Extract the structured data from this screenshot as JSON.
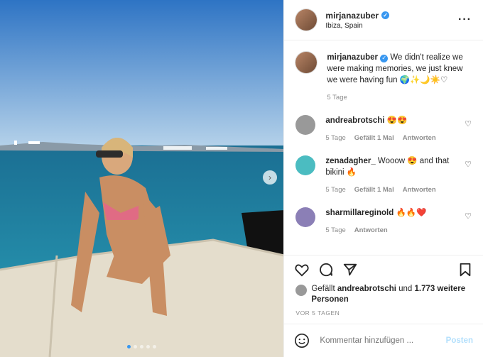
{
  "author": {
    "username": "mirjanazuber",
    "location": "Ibiza, Spain"
  },
  "caption": {
    "username": "mirjanazuber",
    "text": "We didn't realize we were making memories, we just knew we were having fun 🌍✨🌙☀️♡",
    "age": "5 Tage"
  },
  "comments": [
    {
      "username": "andreabrotschi",
      "text": "😍😍",
      "age": "5 Tage",
      "likes": "Gefällt 1 Mal",
      "reply": "Antworten"
    },
    {
      "username": "zenadagher_",
      "text": "Wooow 😍 and that bikini 🔥",
      "age": "5 Tage",
      "likes": "Gefällt 1 Mal",
      "reply": "Antworten"
    },
    {
      "username": "sharmillareginold",
      "text": "🔥🔥❤️",
      "age": "5 Tage",
      "likes": "",
      "reply": "Antworten"
    }
  ],
  "likes": {
    "prefix": "Gefällt",
    "user": "andreabrotschi",
    "mid": "und",
    "others": "1.773 weitere Personen"
  },
  "date": "VOR 5 TAGEN",
  "comment_input": {
    "placeholder": "Kommentar hinzufügen ..."
  },
  "post_button": "Posten",
  "carousel": {
    "count": 5,
    "active": 0
  },
  "colors": {
    "accent": "#3897f0",
    "sea": "#1f7da0",
    "sky": "#3b84c9"
  }
}
